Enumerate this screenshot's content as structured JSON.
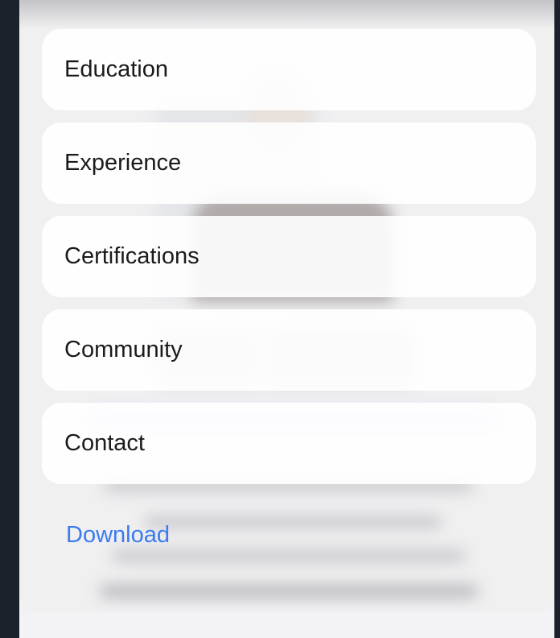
{
  "menu": {
    "items": [
      {
        "label": "Education"
      },
      {
        "label": "Experience"
      },
      {
        "label": "Certifications"
      },
      {
        "label": "Community"
      },
      {
        "label": "Contact"
      }
    ],
    "download_label": "Download"
  },
  "colors": {
    "accent": "#3b7bf0",
    "card": "#ffffff",
    "outer_background": "#1c222b"
  }
}
